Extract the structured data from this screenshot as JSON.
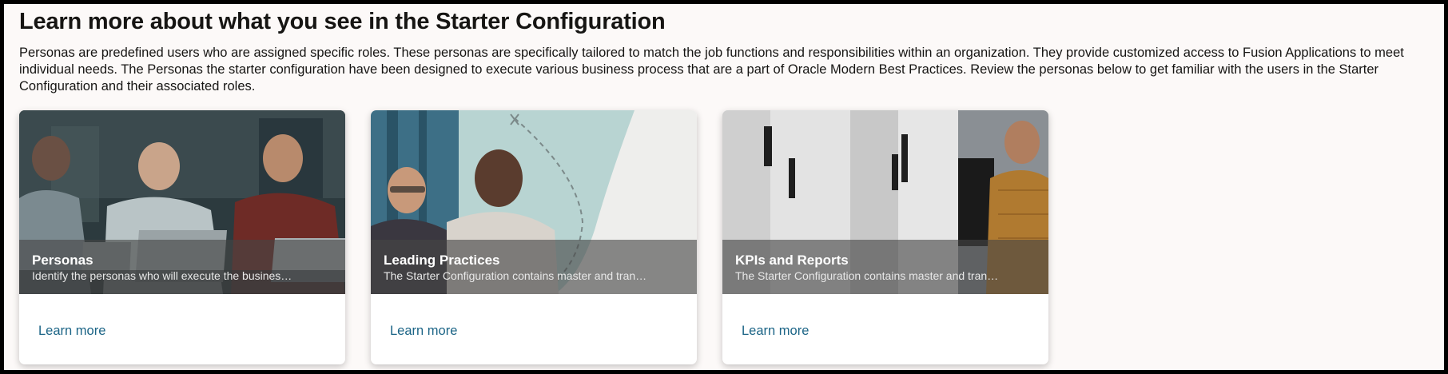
{
  "page": {
    "title": "Learn more about what you see in the Starter Configuration",
    "description": "Personas are predefined users who are assigned specific roles. These personas are specifically tailored to match the job functions and responsibilities within an organization. They provide customized access to Fusion Applications to meet individual needs. The Personas the starter configuration have been designed to execute various business process that are a part of Oracle Modern Best Practices. Review the personas below to get familiar with the users in the Starter Configuration and their associated roles."
  },
  "cards": [
    {
      "title": "Personas",
      "subtitle": "Identify the personas who will execute the business processes in the Starter Configuration",
      "link": "Learn more",
      "image": "team-meeting-photo"
    },
    {
      "title": "Leading Practices",
      "subtitle": "The Starter Configuration contains master and transactional data based on leading practices",
      "link": "Learn more",
      "image": "business-discussion-photo"
    },
    {
      "title": "KPIs and Reports",
      "subtitle": "The Starter Configuration contains master and transactional data used in KPIs and reports",
      "link": "Learn more",
      "image": "server-room-photo"
    }
  ],
  "colors": {
    "background": "#fcf9f8",
    "link": "#1b6486",
    "card_overlay": "#464646",
    "teal_accent": "#b8d4d2"
  }
}
